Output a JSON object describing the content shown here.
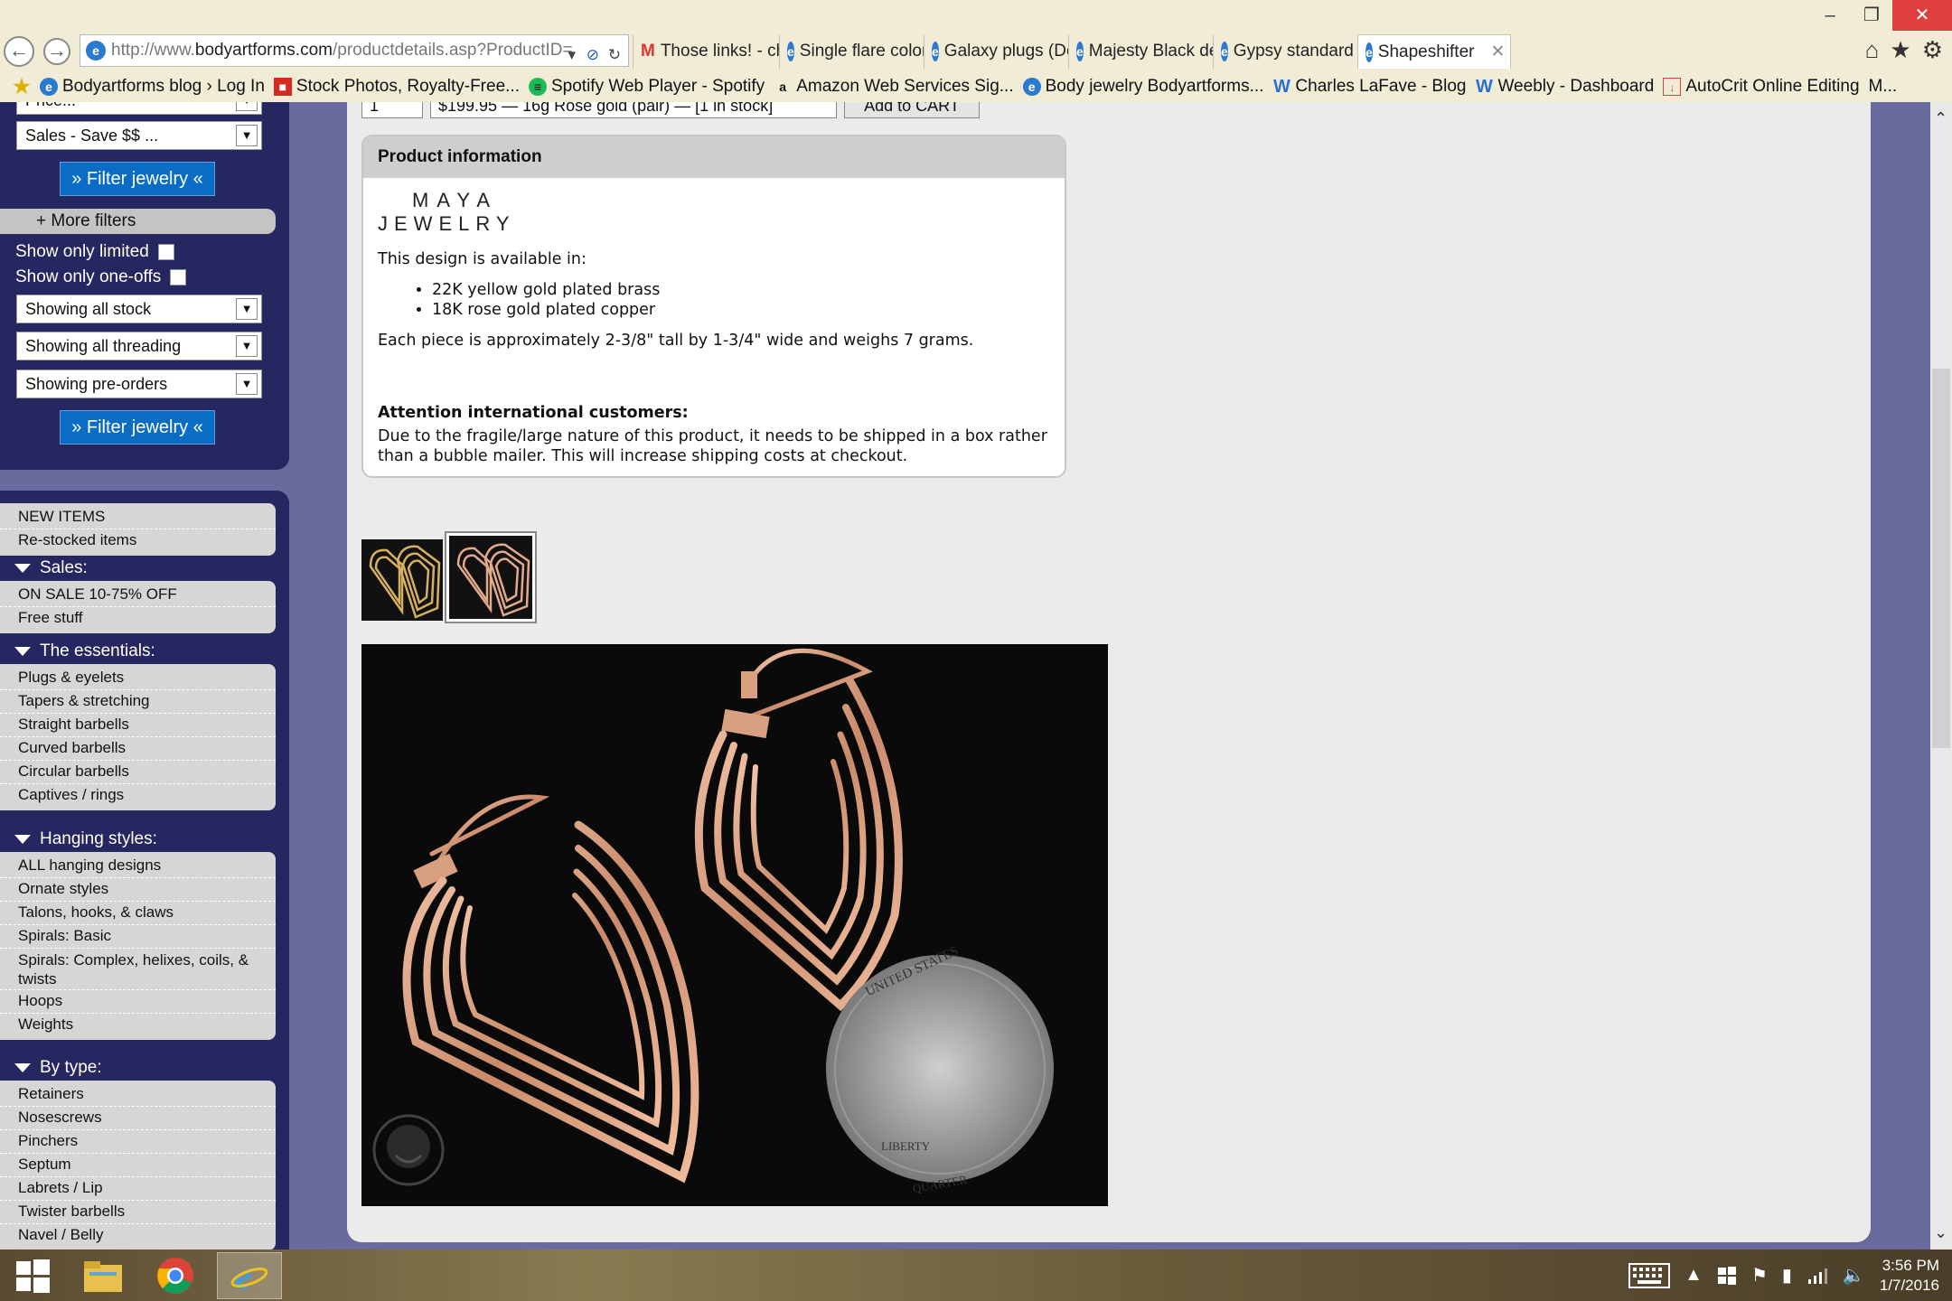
{
  "browser": {
    "url_prefix": "http://www.",
    "url_domain": "bodyartforms.com",
    "url_rest": "/productdetails.asp?ProductID=",
    "tabs": [
      {
        "title": "Those links! - charles.l...",
        "icon": "gmail-icon"
      },
      {
        "title": "Single flare colorfront...",
        "icon": "ie-icon"
      },
      {
        "title": "Galaxy plugs (Double ...",
        "icon": "ie-icon"
      },
      {
        "title": "Majesty Black design",
        "icon": "ie-icon"
      },
      {
        "title": "Gypsy standard",
        "icon": "ie-icon"
      },
      {
        "title": "Shapeshifter",
        "icon": "ie-icon",
        "active": true
      }
    ],
    "favorites": [
      "Bodyartforms blog › Log In",
      "Stock Photos, Royalty-Free...",
      "Spotify Web Player - Spotify",
      "Amazon Web Services Sig...",
      "Body jewelry Bodyartforms...",
      "Charles LaFave - Blog",
      "Weebly - Dashboard",
      "AutoCrit Online Editing",
      "M..."
    ]
  },
  "sidebar": {
    "partial_select": "Price...",
    "sales_select": "Sales - Save $$ ...",
    "filter_label": "» Filter jewelry «",
    "more_filters": "+ More filters",
    "show_limited": "Show only limited",
    "show_oneoffs": "Show only one-offs",
    "stock_select": "Showing all stock",
    "threading_select": "Showing all threading",
    "preorder_select": "Showing pre-orders",
    "top_links": [
      "NEW ITEMS",
      "Re-stocked items"
    ],
    "sections": [
      {
        "title": "Sales:",
        "items": [
          "ON SALE 10-75% OFF",
          "Free stuff"
        ]
      },
      {
        "title": "The essentials:",
        "items": [
          "Plugs & eyelets",
          "Tapers & stretching",
          "Straight barbells",
          "Curved barbells",
          "Circular barbells",
          "Captives / rings"
        ]
      },
      {
        "title": "Hanging styles:",
        "items": [
          "ALL hanging designs",
          "Ornate styles",
          "Talons, hooks, & claws",
          "Spirals: Basic",
          "Spirals: Complex, helixes, coils, & twists",
          "Hoops",
          "Weights"
        ]
      },
      {
        "title": "By type:",
        "items": [
          "Retainers",
          "Nosescrews",
          "Pinchers",
          "Septum",
          "Labrets / Lip",
          "Twister barbells",
          "Navel / Belly"
        ]
      }
    ]
  },
  "product": {
    "qty": "1",
    "option": "$199.95 — 16g Rose gold (pair) — [1 in stock]",
    "add_to_cart": "Add to CART",
    "info_title": "Product information",
    "brand_line1": "MAYA",
    "brand_line2": "JEWELRY",
    "available_intro": "This design is available in:",
    "materials": [
      "22K yellow gold plated brass",
      "18K rose gold plated copper"
    ],
    "dimensions": "Each piece is approximately 2-3/8\" tall by 1-3/4\" wide and weighs 7 grams.",
    "attention_title": "Attention international customers:",
    "attention_body": "Due to the fragile/large nature of this product, it needs to be shipped in a box rather than a bubble mailer. This will increase shipping costs at checkout.",
    "coin_text1": "LIBERTY",
    "coin_text2": "QUARTER",
    "coin_text3": "UNITED STATES"
  },
  "taskbar": {
    "time": "3:56 PM",
    "date": "1/7/2016"
  },
  "colors": {
    "sidebar": "#262660",
    "button": "#0a6cc4",
    "rose_gold": "#e2a98a",
    "yellow_gold": "#d4b060"
  }
}
